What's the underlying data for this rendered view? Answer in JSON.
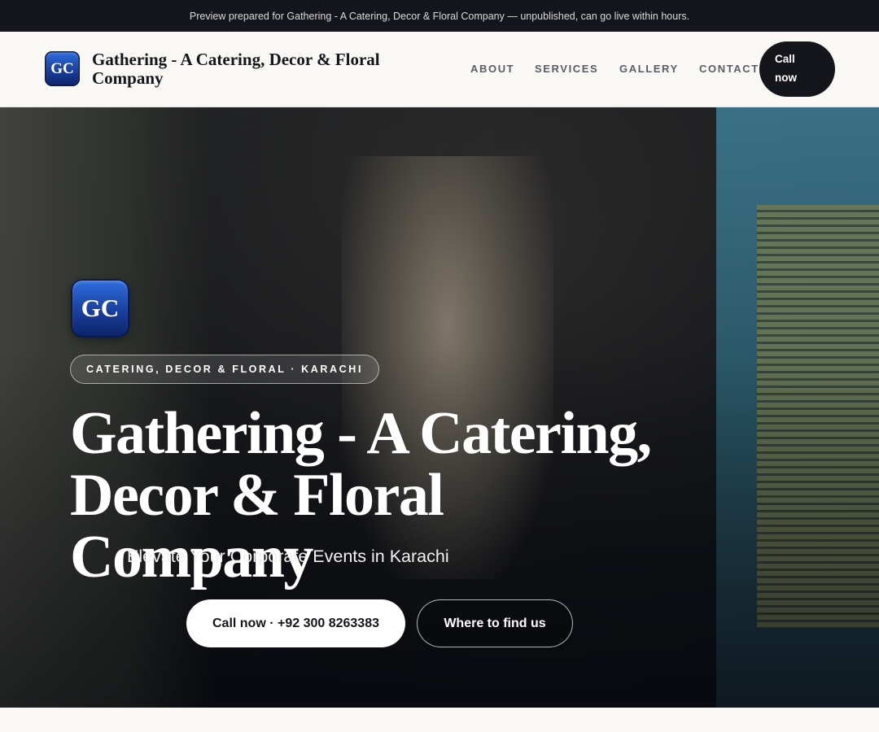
{
  "preview_banner": "Preview prepared for Gathering - A Catering, Decor & Floral Company — unpublished, can go live within hours.",
  "header": {
    "logo_initials": "GC",
    "brand_name": "Gathering - A Catering, Decor & Floral Company",
    "nav": [
      {
        "label": "ABOUT"
      },
      {
        "label": "SERVICES"
      },
      {
        "label": "GALLERY"
      },
      {
        "label": "CONTACT"
      }
    ],
    "call_label": "Call now"
  },
  "hero": {
    "logo_initials": "GC",
    "tagline": "CATERING, DECOR & FLORAL · KARACHI",
    "title": "Gathering - A Catering, Decor & Floral Company",
    "subtitle": "Elevate Your Corporate Events in Karachi",
    "primary_cta": "Call now · +92 300 8263383",
    "secondary_cta": "Where to find us"
  }
}
